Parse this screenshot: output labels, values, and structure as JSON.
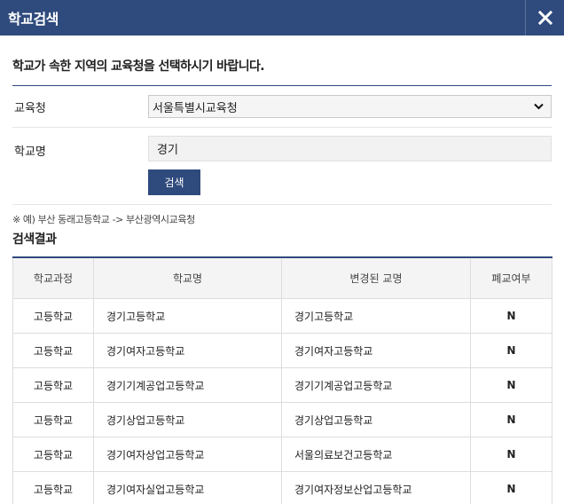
{
  "window": {
    "title": "학교검색"
  },
  "form": {
    "instruction": "학교가 속한 지역의 교육청을 선택하시기 바랍니다.",
    "office_label": "교육청",
    "office_selected": "서울특별시교육청",
    "school_name_label": "학교명",
    "school_name_value": "경기",
    "search_button": "검색",
    "example_text": "※ 예) 부산 동래고등학교 -> 부산광역시교육청"
  },
  "results": {
    "title": "검색결과",
    "columns": [
      "학교과정",
      "학교명",
      "변경된 교명",
      "폐교여부"
    ],
    "rows": [
      {
        "course": "고등학교",
        "name": "경기고등학교",
        "new_name": "경기고등학교",
        "closed": "N"
      },
      {
        "course": "고등학교",
        "name": "경기여자고등학교",
        "new_name": "경기여자고등학교",
        "closed": "N"
      },
      {
        "course": "고등학교",
        "name": "경기기계공업고등학교",
        "new_name": "경기기계공업고등학교",
        "closed": "N"
      },
      {
        "course": "고등학교",
        "name": "경기상업고등학교",
        "new_name": "경기상업고등학교",
        "closed": "N"
      },
      {
        "course": "고등학교",
        "name": "경기여자상업고등학교",
        "new_name": "서울의료보건고등학교",
        "closed": "N"
      },
      {
        "course": "고등학교",
        "name": "경기여자실업고등학교",
        "new_name": "경기여자정보산업고등학교",
        "closed": "N"
      }
    ]
  },
  "icons": {
    "close": "close-icon",
    "dropdown": "chevron-down-icon"
  },
  "colors": {
    "header": "#2f4a7c",
    "button": "#2f4a7c"
  }
}
